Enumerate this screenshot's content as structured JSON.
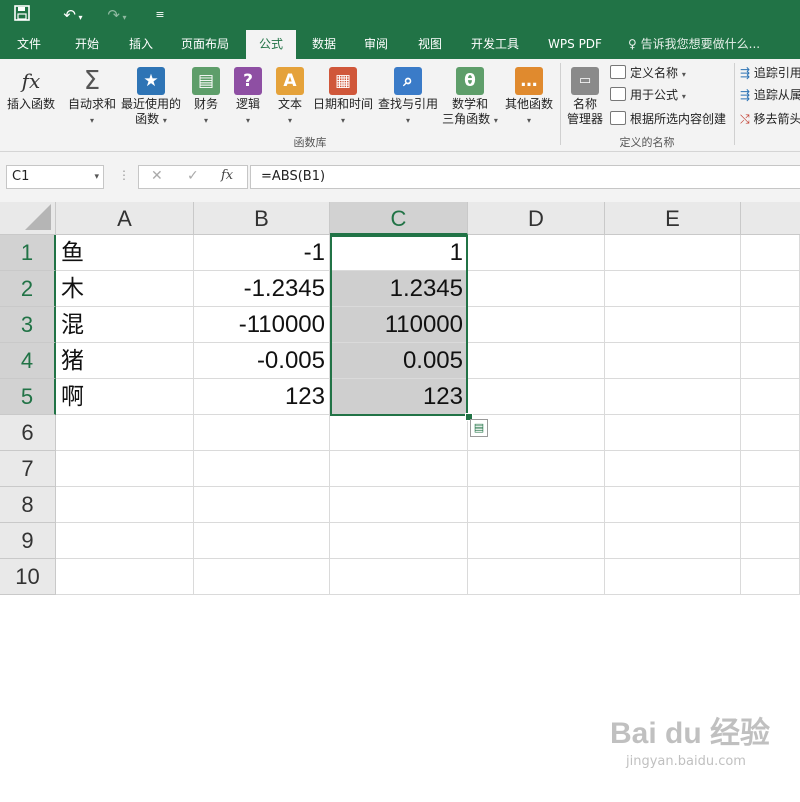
{
  "titlebar": {
    "save_icon": "save-icon",
    "undo_icon": "undo-icon",
    "redo_icon": "redo-icon",
    "customize_icon": "customize-quick-access-icon"
  },
  "tabs": [
    {
      "label": "文件"
    },
    {
      "label": "开始"
    },
    {
      "label": "插入"
    },
    {
      "label": "页面布局"
    },
    {
      "label": "公式",
      "active": true
    },
    {
      "label": "数据"
    },
    {
      "label": "审阅"
    },
    {
      "label": "视图"
    },
    {
      "label": "开发工具"
    },
    {
      "label": "WPS PDF"
    }
  ],
  "tell_me": "告诉我您想要做什么...",
  "ribbon": {
    "insert_function": {
      "icon": "fx",
      "label": "插入函数"
    },
    "library": [
      {
        "icon": "Σ",
        "line1": "自动求和",
        "line2": "",
        "color": "#5a5a5a"
      },
      {
        "icon": "★",
        "line1": "最近使用的",
        "line2": "函数",
        "color": "#2e74b5"
      },
      {
        "icon": "▤",
        "line1": "财务",
        "line2": "",
        "color": "#5e9e6a"
      },
      {
        "icon": "?",
        "line1": "逻辑",
        "line2": "",
        "color": "#8e4fa3"
      },
      {
        "icon": "A",
        "line1": "文本",
        "line2": "",
        "color": "#e5a23a"
      },
      {
        "icon": "▦",
        "line1": "日期和时间",
        "line2": "",
        "color": "#d0573a"
      },
      {
        "icon": "⌕",
        "line1": "查找与引用",
        "line2": "",
        "color": "#3a7bc8"
      },
      {
        "icon": "θ",
        "line1": "数学和",
        "line2": "三角函数",
        "color": "#5e9e6a"
      },
      {
        "icon": "…",
        "line1": "其他函数",
        "line2": "",
        "color": "#e08a2e"
      }
    ],
    "library_group": "函数库",
    "name_manager": {
      "line1": "名称",
      "line2": "管理器"
    },
    "defined_names": [
      "定义名称",
      "用于公式",
      "根据所选内容创建"
    ],
    "defined_group": "定义的名称",
    "audit": [
      "追踪引用",
      "追踪从属",
      "移去箭头"
    ]
  },
  "formula_bar": {
    "name_box": "C1",
    "formula": "=ABS(B1)",
    "cancel_icon": "✕",
    "enter_icon": "✓",
    "fx_icon": "fx"
  },
  "grid": {
    "columns": [
      "A",
      "B",
      "C",
      "D",
      "E"
    ],
    "selected_column": "C",
    "rows": [
      {
        "n": "1",
        "a": "鱼",
        "b": "-1",
        "c": "1"
      },
      {
        "n": "2",
        "a": "木",
        "b": "-1.2345",
        "c": "1.2345"
      },
      {
        "n": "3",
        "a": "混",
        "b": "-110000",
        "c": "110000"
      },
      {
        "n": "4",
        "a": "猪",
        "b": "-0.005",
        "c": "0.005"
      },
      {
        "n": "5",
        "a": "啊",
        "b": "123",
        "c": "123"
      },
      {
        "n": "6",
        "a": "",
        "b": "",
        "c": ""
      },
      {
        "n": "7",
        "a": "",
        "b": "",
        "c": ""
      },
      {
        "n": "8",
        "a": "",
        "b": "",
        "c": ""
      },
      {
        "n": "9",
        "a": "",
        "b": "",
        "c": ""
      },
      {
        "n": "10",
        "a": "",
        "b": "",
        "c": ""
      }
    ]
  },
  "watermark": {
    "brand": "Bai du 经验",
    "url": "jingyan.baidu.com"
  }
}
